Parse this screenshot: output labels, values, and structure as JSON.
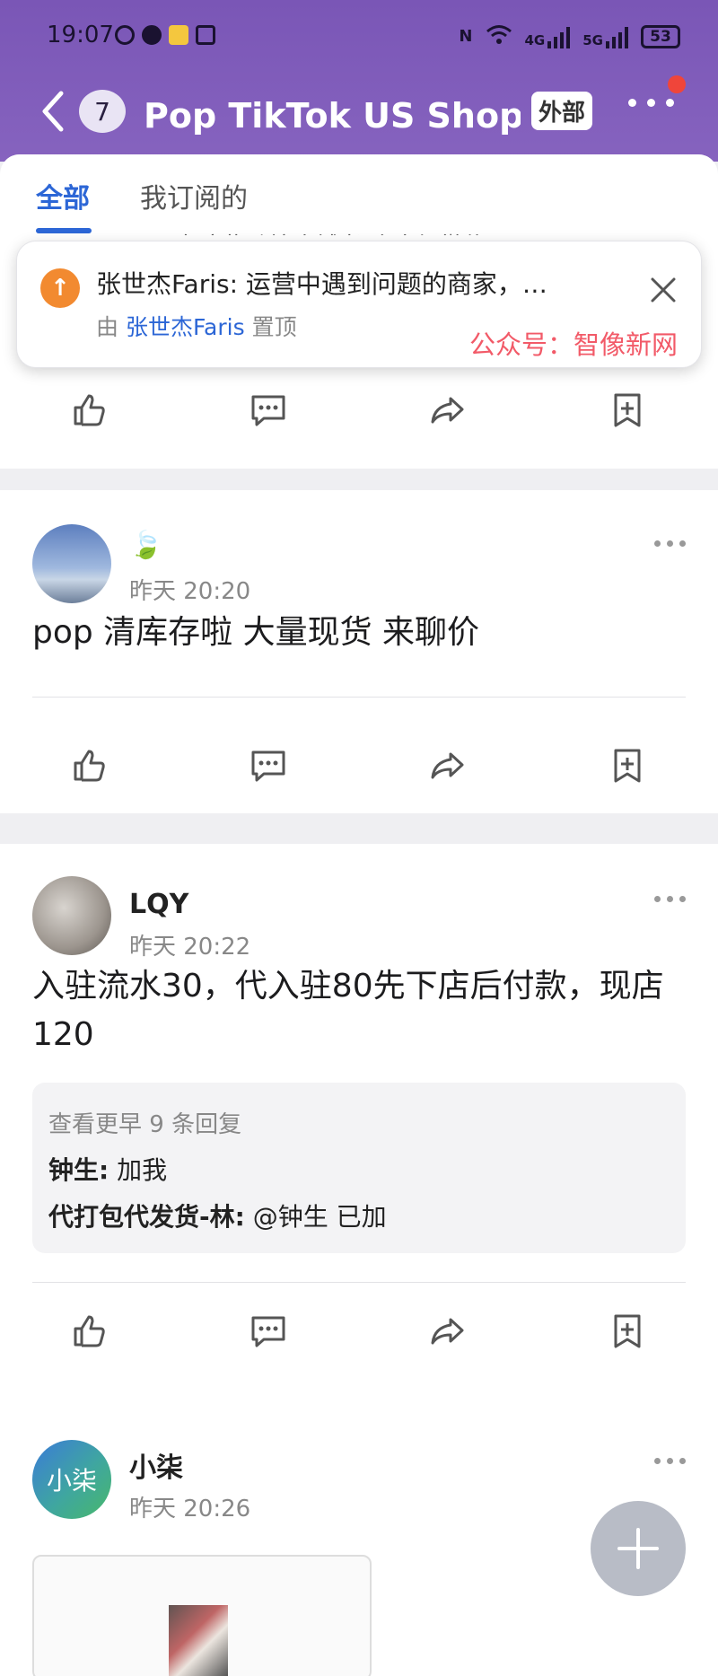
{
  "status_bar": {
    "time": "19:07",
    "network_1": "4G",
    "network_2": "5G",
    "battery": "53"
  },
  "header": {
    "unread_count": "7",
    "title": "Pop TikTok US Shop跨…",
    "external_badge": "外部"
  },
  "tabs": [
    {
      "label": "全部"
    },
    {
      "label": "我订阅的"
    }
  ],
  "peek_text": "…有这些跨境店铺老 会来加微信 ’",
  "pinned": {
    "text": "张世杰Faris: 运营中遇到问题的商家，…",
    "by_prefix": "由",
    "by_user": "张世杰Faris",
    "by_suffix": "置顶",
    "watermark": "公众号：智像新网"
  },
  "posts": [
    {
      "author": "🍃",
      "time": "昨天 20:20",
      "body": "pop 清库存啦 大量现货 来聊价"
    },
    {
      "author": "LQY",
      "time": "昨天 20:22",
      "body": "入驻流水30，代入驻80先下店后付款，现店120",
      "replies": {
        "more": "查看更早 9 条回复",
        "items": [
          {
            "name": "钟生:",
            "text": " 加我"
          },
          {
            "name": "代打包代发货-林:",
            "text": " @钟生 已加"
          }
        ]
      }
    },
    {
      "author": "小柒",
      "avatar_text": "小柒",
      "time": "昨天 20:26"
    }
  ],
  "colors": {
    "header": "#7a56b6",
    "accent": "#2c66d6",
    "pin": "#f28a30",
    "badge": "#f0453a"
  }
}
